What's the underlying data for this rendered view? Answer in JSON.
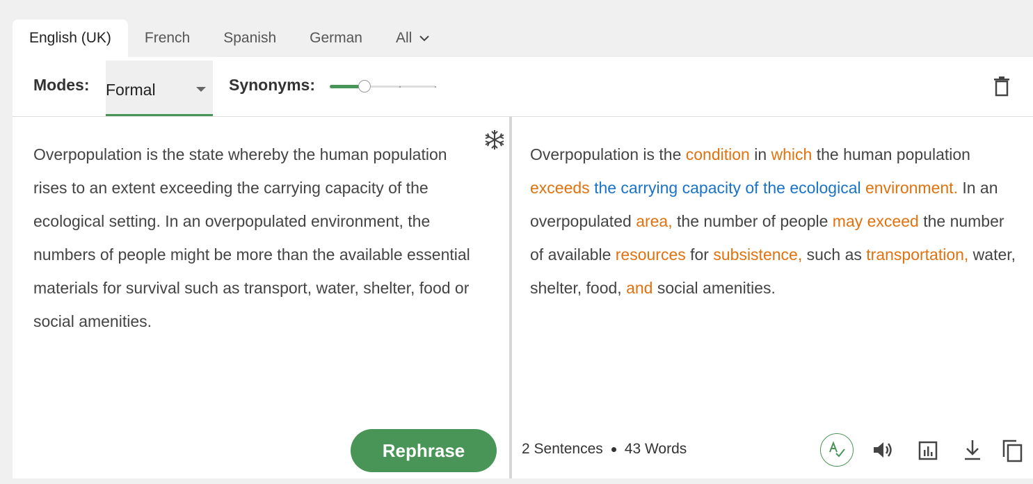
{
  "tabs": [
    {
      "label": "English (UK)",
      "active": true
    },
    {
      "label": "French"
    },
    {
      "label": "Spanish"
    },
    {
      "label": "German"
    },
    {
      "label": "All"
    }
  ],
  "toolbar": {
    "modes_label": "Modes:",
    "mode_value": "Formal",
    "synonyms_label": "Synonyms:",
    "synonyms_level": 0.33,
    "synonyms_steps": 4
  },
  "input": {
    "text": "Overpopulation is the state whereby the human population rises to an extent exceeding the carrying capacity of the ecological setting. In an overpopulated environment, the numbers of people might be more than the available essential materials for survival such as transport, water, shelter, food or social amenities."
  },
  "output": {
    "segments": [
      {
        "t": "Overpopulation is the ",
        "c": ""
      },
      {
        "t": "condition",
        "c": "orange"
      },
      {
        "t": " in ",
        "c": ""
      },
      {
        "t": "which",
        "c": "orange"
      },
      {
        "t": " the human population ",
        "c": ""
      },
      {
        "t": "exceeds",
        "c": "orange"
      },
      {
        "t": " ",
        "c": ""
      },
      {
        "t": "the carrying capacity of the ecological",
        "c": "blue"
      },
      {
        "t": " ",
        "c": ""
      },
      {
        "t": "environment.",
        "c": "orange"
      },
      {
        "t": " In an overpopulated ",
        "c": ""
      },
      {
        "t": "area,",
        "c": "orange"
      },
      {
        "t": " the number of people ",
        "c": ""
      },
      {
        "t": "may exceed",
        "c": "orange"
      },
      {
        "t": " the number of available ",
        "c": ""
      },
      {
        "t": "resources",
        "c": "orange"
      },
      {
        "t": " for ",
        "c": ""
      },
      {
        "t": "subsistence,",
        "c": "orange"
      },
      {
        "t": " such as ",
        "c": ""
      },
      {
        "t": "transportation,",
        "c": "orange"
      },
      {
        "t": " water, shelter, food, ",
        "c": ""
      },
      {
        "t": "and",
        "c": "orange"
      },
      {
        "t": " social amenities.",
        "c": ""
      }
    ]
  },
  "actions": {
    "rephrase_label": "Rephrase"
  },
  "stats": {
    "sentences": "2 Sentences",
    "words": "43 Words"
  },
  "colors": {
    "accent": "#499557",
    "changed": "#e0720f",
    "structural": "#1a73c8"
  },
  "icons": [
    "chevron-down-icon",
    "trash-icon",
    "freeze-words-icon",
    "grammar-check-icon",
    "volume-icon",
    "bar-chart-icon",
    "download-icon",
    "copy-icon"
  ]
}
